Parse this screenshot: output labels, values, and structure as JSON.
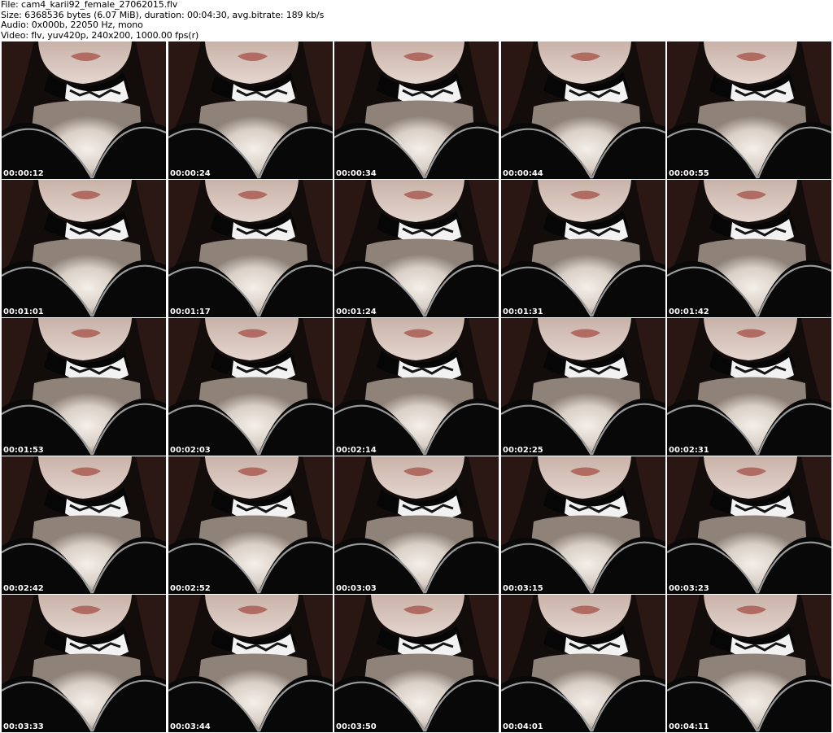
{
  "info": {
    "file_line": "File: cam4_karii92_female_27062015.flv",
    "size_line": "Size: 6368536 bytes (6.07 MiB), duration: 00:04:30, avg.bitrate: 189 kb/s",
    "audio_line": "Audio: 0x000b, 22050 Hz, mono",
    "video_line": "Video: flv, yuv420p, 240x200, 1000.00 fps(r)"
  },
  "colors": {
    "background": "#ffffff",
    "header_text": "#000000",
    "timestamp_text": "#ffffff"
  },
  "frame_icon": "video-frame-thumbnail",
  "timestamps": [
    "00:00:12",
    "00:00:24",
    "00:00:34",
    "00:00:44",
    "00:00:55",
    "00:01:01",
    "00:01:17",
    "00:01:24",
    "00:01:31",
    "00:01:42",
    "00:01:53",
    "00:02:03",
    "00:02:14",
    "00:02:25",
    "00:02:31",
    "00:02:42",
    "00:02:52",
    "00:03:03",
    "00:03:15",
    "00:03:23",
    "00:03:33",
    "00:03:44",
    "00:03:50",
    "00:04:01",
    "00:04:11"
  ]
}
